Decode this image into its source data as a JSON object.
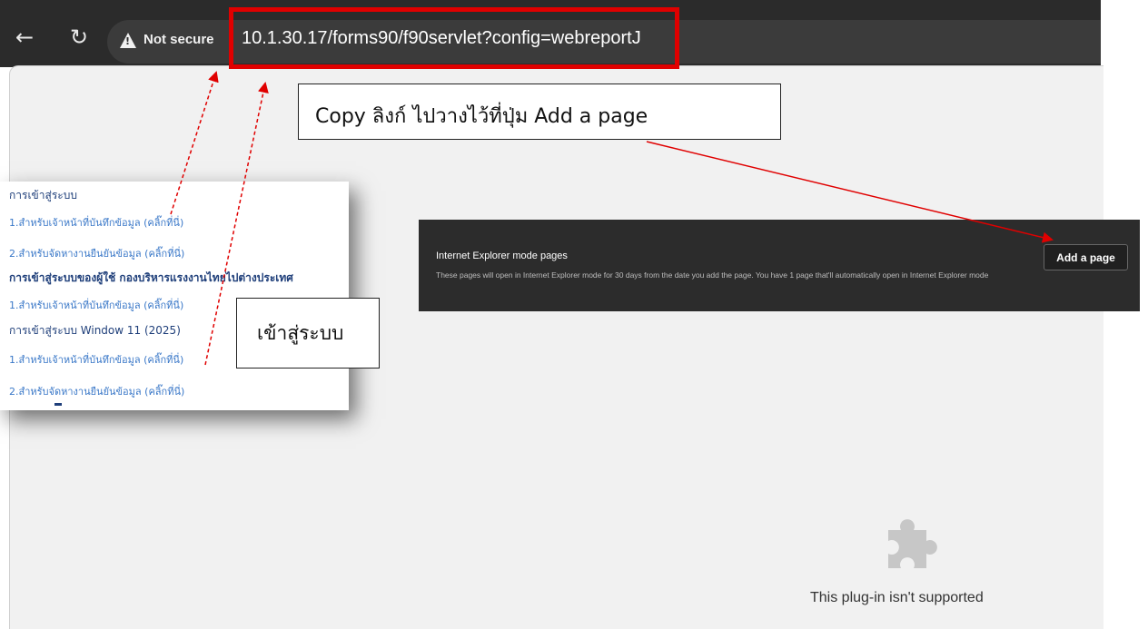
{
  "browser": {
    "back_icon": "arrow-left-icon",
    "reload_icon": "reload-icon",
    "security_label": "Not secure",
    "url": "10.1.30.17/forms90/f90servlet?config=webreportJ"
  },
  "callouts": {
    "copy_instruction": "Copy ลิงก์  ไปวางไว้ที่ปุ่ม Add a page",
    "login_label": "เข้าสู่ระบบ"
  },
  "login_menu": {
    "sections": [
      {
        "heading": "การเข้าสู่ระบบ",
        "links": [
          "1.สำหรับเจ้าหน้าที่บันทึกข้อมูล (คลิ๊กที่นี่)",
          "2.สำหรับจัดหางานยืนยันข้อมูล (คลิ๊กที่นี่)"
        ]
      },
      {
        "heading": "การเข้าสู่ระบบของผู้ใช้ กองบริหารแรงงานไทยไปต่างประเทศ",
        "links": [
          "1.สำหรับเจ้าหน้าที่บันทึกข้อมูล (คลิ๊กที่นี่)"
        ]
      },
      {
        "heading": "การเข้าสู่ระบบ Window 11 (2025)",
        "links": [
          "1.สำหรับเจ้าหน้าที่บันทึกข้อมูล (คลิ๊กที่นี่)",
          "2.สำหรับจัดหางานยืนยันข้อมูล (คลิ๊กที่นี่)"
        ]
      }
    ]
  },
  "ie_mode": {
    "title": "Internet Explorer mode pages",
    "description": "These pages will open in Internet Explorer mode for 30 days from the date you add the page. You have 1 page that'll automatically open in Internet Explorer mode",
    "add_button": "Add a page"
  },
  "plugin": {
    "icon": "puzzle-piece-icon",
    "message": "This plug-in isn't supported"
  },
  "colors": {
    "highlight_red": "#e00000",
    "link_blue": "#3a78c8",
    "heading_navy": "#1f3f7a"
  }
}
